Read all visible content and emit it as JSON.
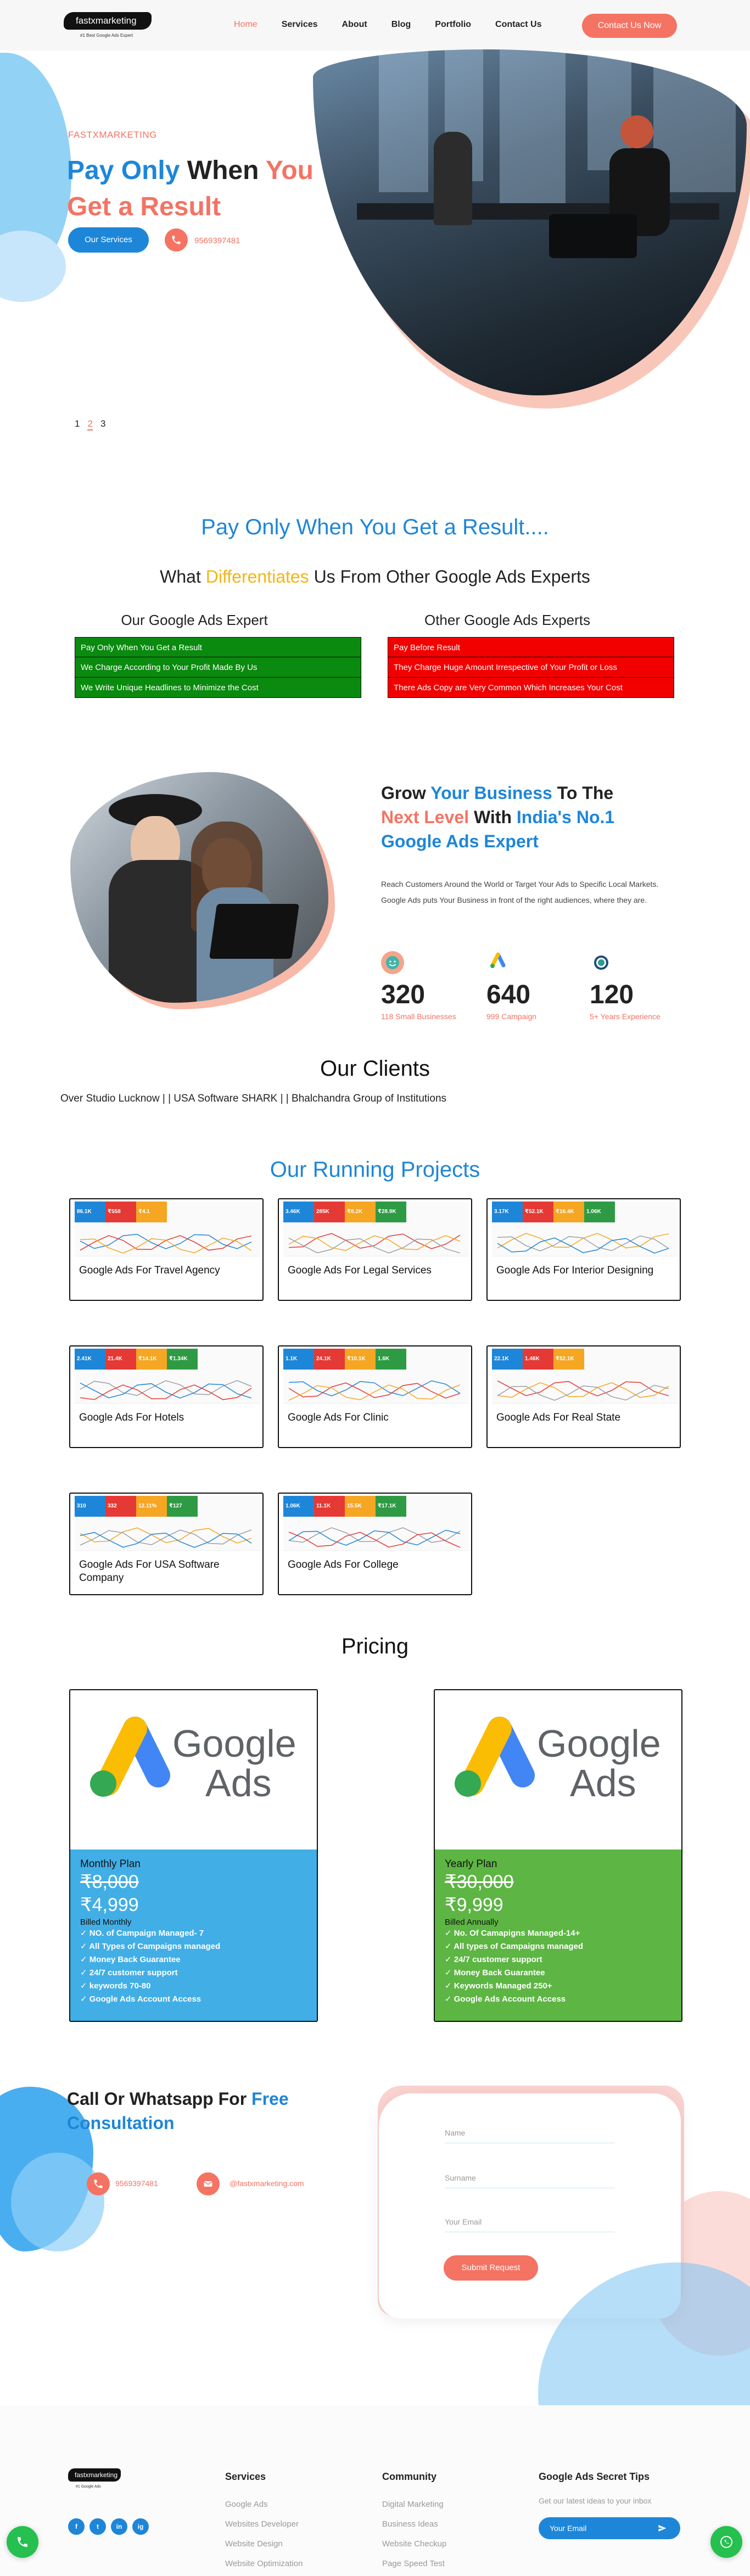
{
  "header": {
    "logo_text": "fastxmarketing",
    "logo_tagline": "#1 Best Google Ads Expert",
    "nav": [
      "Home",
      "Services",
      "About",
      "Blog",
      "Portfolio",
      "Contact Us"
    ],
    "cta": "Contact Us Now"
  },
  "hero": {
    "eyebrow": "FASTXMARKETING",
    "title_1": "Pay Only",
    "title_2": " When ",
    "title_3": "You",
    "title_4": "Get a Result",
    "button": "Our Services",
    "phone": "9569397481",
    "slides": [
      "1",
      "2",
      "3"
    ]
  },
  "compare": {
    "headline": "Pay Only When You Get a Result....",
    "sub_1": "What ",
    "sub_2": "Differentiates",
    "sub_3": " Us From Other Google Ads Experts",
    "ours_title": "Our Google Ads Expert",
    "ours": [
      "Pay Only When You Get a Result",
      "We Charge According to Your Profit Made By Us",
      "We Write Unique Headlines to Minimize the Cost"
    ],
    "others_title": "Other Google Ads Experts",
    "others": [
      "Pay Before Result",
      "They Charge Huge Amount Irrespective of Your Profit or Loss",
      "There Ads Copy are Very Common Which Increases Your Cost"
    ]
  },
  "grow": {
    "t1": "Grow ",
    "t2": "Your Business",
    "t3": " To The",
    "t4": "Next Level",
    "t5": " With ",
    "t6": "India's No.1",
    "t7": "Google Ads Expert",
    "text": "Reach Customers Around the World or Target Your Ads to Specific Local Markets. Google Ads puts Your Business in front of the right audiences, where they are.",
    "stats": [
      {
        "num": "320",
        "label": "118 Small Businesses"
      },
      {
        "num": "640",
        "label": "999 Campaign"
      },
      {
        "num": "120",
        "label": "5+ Years Experience"
      }
    ]
  },
  "clients": {
    "title": "Our Clients",
    "marquee": "Over Studio Lucknow | | USA Software SHARK | | Bhalchandra Group of Institutions"
  },
  "projects": {
    "title": "Our Running Projects",
    "items": [
      {
        "label": "Google Ads For Travel Agency",
        "tiles": [
          "86.1K",
          "₹558",
          "₹4.1"
        ]
      },
      {
        "label": "Google Ads For Legal Services",
        "tiles": [
          "3.46K",
          "285K",
          "₹8.2K",
          "₹28.9K"
        ]
      },
      {
        "label": "Google Ads For Interior Designing",
        "tiles": [
          "3.17K",
          "₹52.1K",
          "₹16.4K",
          "1.06K"
        ]
      },
      {
        "label": "Google Ads For Hotels",
        "tiles": [
          "2.41K",
          "21.4K",
          "₹14.1K",
          "₹1.34K"
        ]
      },
      {
        "label": "Google Ads For Clinic",
        "tiles": [
          "1.1K",
          "24.1K",
          "₹10.1K",
          "1.6K"
        ]
      },
      {
        "label": "Google Ads For Real State",
        "tiles": [
          "22.1K",
          "1.46K",
          "₹52.1K"
        ]
      },
      {
        "label": "Google Ads For USA Software Company",
        "tiles": [
          "310",
          "332",
          "12.11%",
          "₹127"
        ]
      },
      {
        "label": "Google Ads For College",
        "tiles": [
          "1.06K",
          "11.1K",
          "15.5K",
          "₹17.1K"
        ]
      }
    ]
  },
  "pricing": {
    "title": "Pricing",
    "logo_line_1": "Google",
    "logo_line_2": "Ads",
    "plans": [
      {
        "name": "Monthly Plan",
        "old": "₹8,000",
        "price": "₹4,999",
        "billed": "Billed Monthly",
        "features": [
          "NO. of Campaign Managed- 7",
          "All Types of Campaigns managed",
          "Money Back Guarantee",
          "24/7 customer support",
          "keywords 70-80",
          "Google Ads Account Access"
        ]
      },
      {
        "name": "Yearly Plan",
        "old": "₹30,000",
        "price": "₹9,999",
        "billed": "Billed Annually",
        "features": [
          "No. Of Camapigns Managed-14+",
          "All types of Campaigns managed",
          "24/7 customer support",
          "Money Back Guarantee",
          "Keywords Managed 250+",
          "Google Ads Account Access"
        ]
      }
    ]
  },
  "contact": {
    "t1": "Call Or Whatsapp For ",
    "t2": "Free",
    "t3": "Consultation",
    "phone": "9569397481",
    "email": "@fastxmarketing.com",
    "form": {
      "name": "Name",
      "surname": "Surname",
      "email": "Your Email",
      "submit": "Submit Request"
    }
  },
  "footer": {
    "logo_text": "fastxmarketing",
    "logo_tagline": "#1 Google Ads",
    "socials": [
      "f",
      "t",
      "in",
      "ig"
    ],
    "services_head": "Services",
    "services": [
      "Google Ads",
      "Websites Developer",
      "Website Design",
      "Website Optimization"
    ],
    "community_head": "Community",
    "community": [
      "Digital Marketing",
      "Business Ideas",
      "Website Checkup",
      "Page Speed Test"
    ],
    "tips_head": "Google Ads Secret Tips",
    "tips_sub": "Get our latest ideas to your inbox",
    "tips_placeholder": "Your Email"
  },
  "colors": {
    "accent_blue": "#1e86d8",
    "accent_coral": "#f47363",
    "accent_yellow": "#f5b515",
    "green": "#0a8a0e",
    "red": "#f20000"
  }
}
